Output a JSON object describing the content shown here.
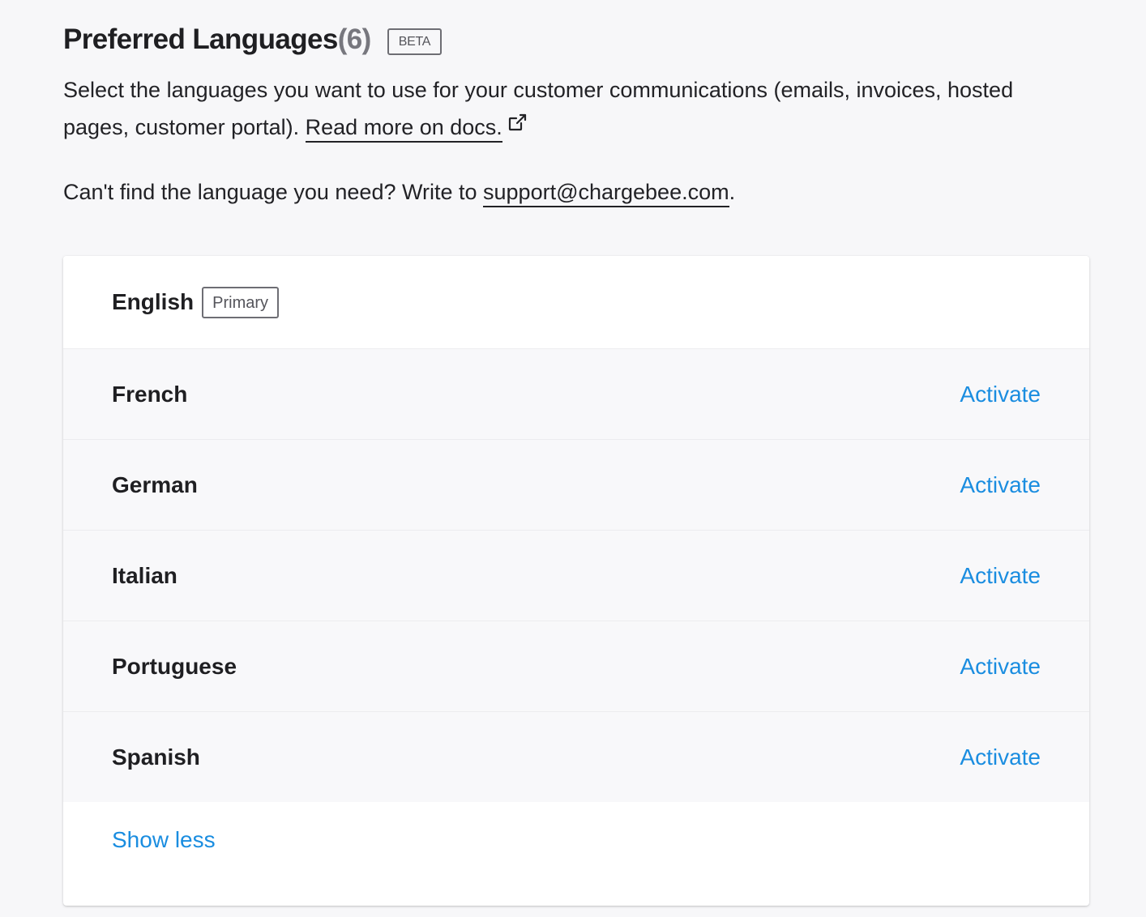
{
  "header": {
    "title": "Preferred Languages",
    "count": "(6)",
    "badge": "BETA"
  },
  "description": {
    "text": "Select the languages you want to use for your customer communications (emails, invoices, hosted pages, customer portal). ",
    "docs_link": "Read more on docs.",
    "docs_icon": "external-link-icon"
  },
  "help": {
    "text": "Can't find the language you need? Write to ",
    "email": "support@chargebee.com",
    "suffix": "."
  },
  "languages": {
    "primary": {
      "name": "English",
      "badge": "Primary"
    },
    "items": [
      {
        "name": "French",
        "action": "Activate"
      },
      {
        "name": "German",
        "action": "Activate"
      },
      {
        "name": "Italian",
        "action": "Activate"
      },
      {
        "name": "Portuguese",
        "action": "Activate"
      },
      {
        "name": "Spanish",
        "action": "Activate"
      }
    ],
    "toggle_label": "Show less"
  },
  "colors": {
    "accent": "#1a8de0",
    "background": "#f7f7f9",
    "text": "#212124"
  }
}
